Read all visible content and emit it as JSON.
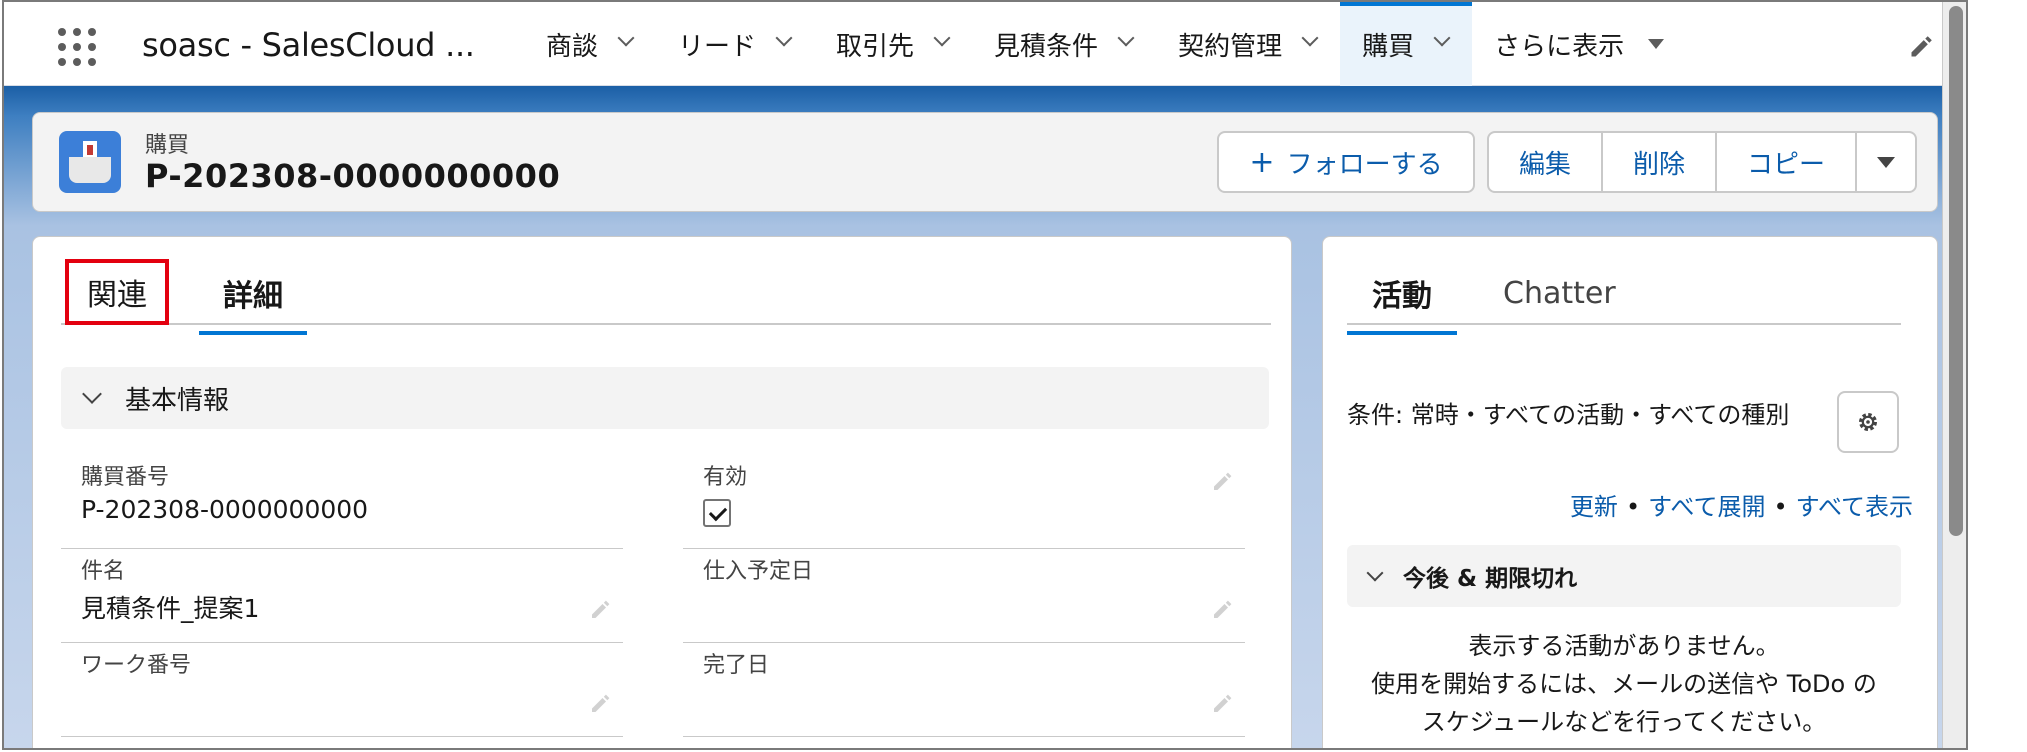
{
  "nav": {
    "app_name": "soasc - SalesCloud ...",
    "items": [
      {
        "label": "商談"
      },
      {
        "label": "リード"
      },
      {
        "label": "取引先"
      },
      {
        "label": "見積条件"
      },
      {
        "label": "契約管理"
      },
      {
        "label": "購買"
      },
      {
        "label": "さらに表示"
      }
    ],
    "active_item": "購買",
    "accent_color": "#0176d3"
  },
  "header": {
    "object_type": "購買",
    "record_name": "P-202308-0000000000",
    "icon": "purchase-basket-icon",
    "buttons": {
      "follow": "フォローする",
      "edit": "編集",
      "delete": "削除",
      "copy": "コピー"
    }
  },
  "main": {
    "tabs": [
      {
        "label": "関連"
      },
      {
        "label": "詳細"
      }
    ],
    "active_tab": "詳細",
    "highlighted_tab": "関連",
    "section": {
      "title": "基本情報",
      "fields": [
        {
          "label": "購買番号",
          "value": "P-202308-0000000000"
        },
        {
          "label": "有効",
          "checked": true
        },
        {
          "label": "件名",
          "value": "見積条件_提案1"
        },
        {
          "label": "仕入予定日",
          "value": ""
        },
        {
          "label": "ワーク番号",
          "value": ""
        },
        {
          "label": "完了日",
          "value": ""
        }
      ]
    }
  },
  "activity": {
    "tabs": [
      {
        "label": "活動"
      },
      {
        "label": "Chatter"
      }
    ],
    "filter_text": "条件: 常時・すべての活動・すべての種別",
    "links": {
      "refresh": "更新",
      "expand_all": "すべて展開",
      "show_all": "すべて表示",
      "separator": "•"
    },
    "upcoming_title": "今後 & 期限切れ",
    "empty_line1": "表示する活動がありません。",
    "empty_line2": "使用を開始するには、メールの送信や ToDo の",
    "empty_line3": "スケジュールなどを行ってください。"
  }
}
